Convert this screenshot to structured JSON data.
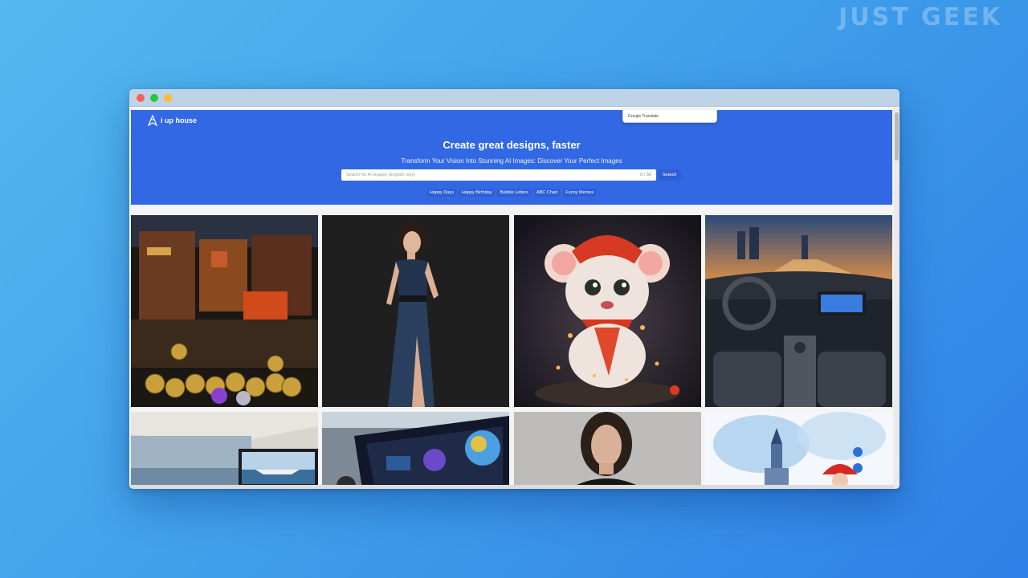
{
  "watermark": "JUST GEEK",
  "site": {
    "logo_text": "i up house",
    "google_translate": "Google Translate",
    "title": "Create great designs, faster",
    "subtitle": "Transform Your Vision Into Stunning AI Images: Discover Your Perfect Images",
    "search": {
      "placeholder": "Search for AI images (English only)",
      "counter": "0 / 50",
      "button": "Search"
    },
    "tags": [
      "Happy Days",
      "Happy Birthday",
      "Bubble Letters",
      "ABC Chart",
      "Funny Memes"
    ]
  },
  "gallery": [
    {
      "name": "crypto-market-image",
      "desc": "Market stall with bitcoins"
    },
    {
      "name": "woman-blue-dress-image",
      "desc": "Woman in blue satin dress"
    },
    {
      "name": "cartoon-mouse-image",
      "desc": "Cartoon mouse with red hat"
    },
    {
      "name": "car-interior-image",
      "desc": "Car interior city lights"
    },
    {
      "name": "yacht-screen-image",
      "desc": "Office screen showing yacht"
    },
    {
      "name": "dashboard-screen-image",
      "desc": "Monitor with data dashboard"
    },
    {
      "name": "woman-portrait-image",
      "desc": "Woman portrait grey background"
    },
    {
      "name": "winter-castle-image",
      "desc": "Watercolor winter castle with santa"
    }
  ],
  "colors": {
    "hero": "#3268e3",
    "search_button": "#2d60d6"
  }
}
